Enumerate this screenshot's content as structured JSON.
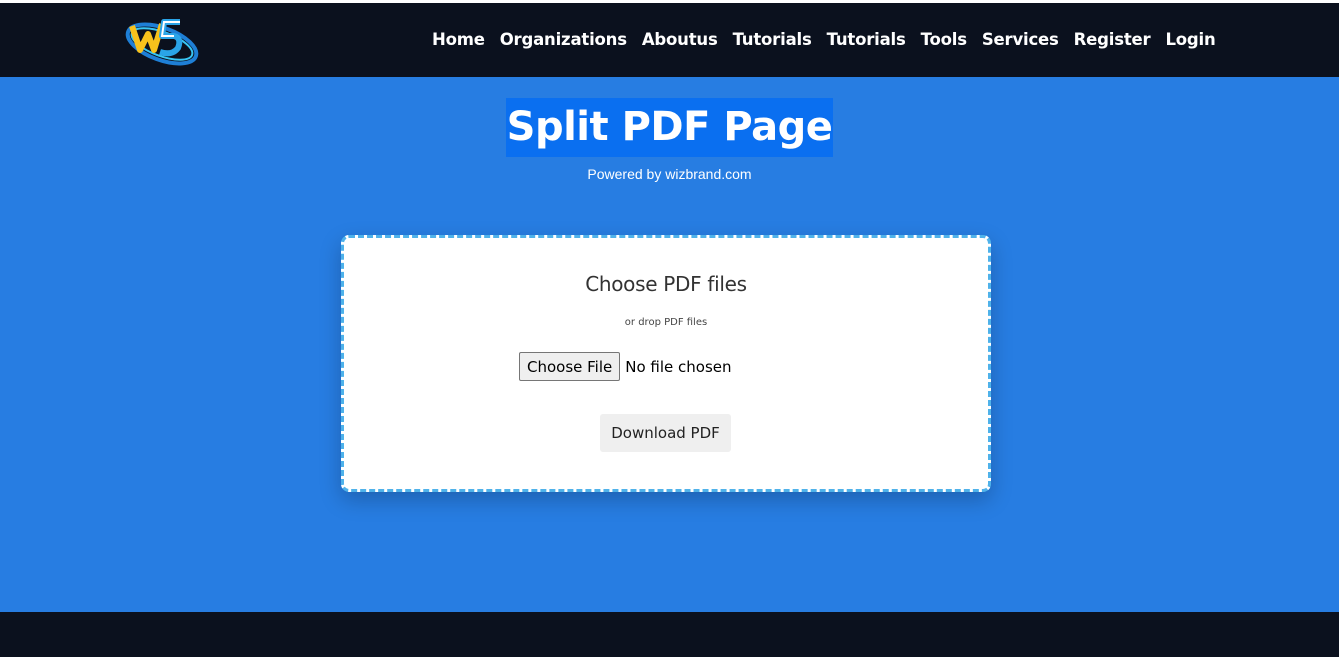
{
  "brand": {
    "logo_icon": "wizbrand-ws-logo",
    "colors": {
      "nav_bg": "#0b111e",
      "hero_bg": "#277de2",
      "title_highlight": "#0a6ff0",
      "card_border": "#4fb2ea",
      "footer_bg": "#0b111e"
    }
  },
  "nav": {
    "items": [
      "Home",
      "Organizations",
      "Aboutus",
      "Tutorials",
      "Tutorials",
      "Tools",
      "Services",
      "Register",
      "Login"
    ]
  },
  "hero": {
    "title": "Split PDF Page",
    "subtitle": "Powered by wizbrand.com"
  },
  "uploader": {
    "heading": "Choose PDF files",
    "hint": "or drop PDF files",
    "choose_button": "Choose File",
    "file_status": "No file chosen",
    "download_button": "Download PDF"
  }
}
